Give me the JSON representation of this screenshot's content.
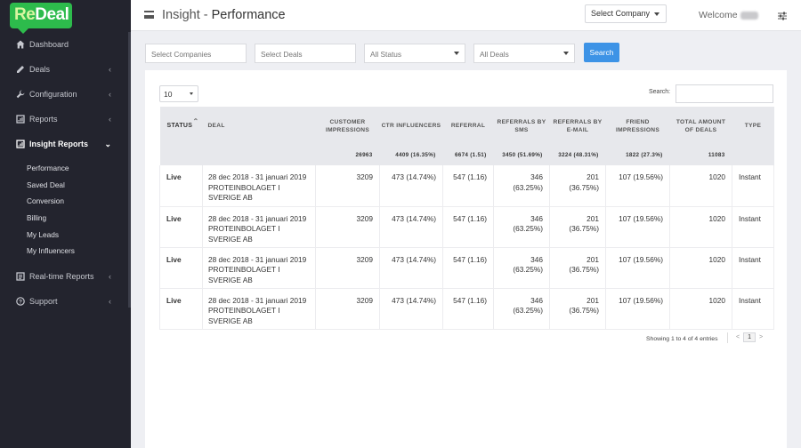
{
  "brand": {
    "logo_re": "Re",
    "logo_rest": "Deal"
  },
  "sidebar": {
    "items": [
      {
        "label": "Dashboard"
      },
      {
        "label": "Deals"
      },
      {
        "label": "Configuration"
      },
      {
        "label": "Reports"
      },
      {
        "label": "Insight Reports"
      },
      {
        "label": "Real-time Reports"
      },
      {
        "label": "Support"
      }
    ],
    "insight_sub": [
      {
        "label": "Performance"
      },
      {
        "label": "Saved Deal"
      },
      {
        "label": "Conversion"
      },
      {
        "label": "Billing"
      },
      {
        "label": "My Leads"
      },
      {
        "label": "My Influencers"
      }
    ]
  },
  "header": {
    "title_prefix": "Insight - ",
    "title_main": "Performance",
    "company_select": "Select Company",
    "welcome": "Welcome"
  },
  "filters": {
    "companies_placeholder": "Select Companies",
    "deals_placeholder": "Select Deals",
    "status": "All Status",
    "deals": "All Deals",
    "search_button": "Search"
  },
  "table_controls": {
    "page_length": "10",
    "search_label": "Search:",
    "info": "Showing 1 to 4 of 4 entries",
    "prev": "<",
    "page": "1",
    "next": ">"
  },
  "table": {
    "headers": [
      {
        "label": "STATUS"
      },
      {
        "label": "DEAL"
      },
      {
        "label": "CUSTOMER IMPRESSIONS"
      },
      {
        "label": "CTR INFLUENCERS"
      },
      {
        "label": "REFERRAL"
      },
      {
        "label": "REFERRALS BY SMS"
      },
      {
        "label": "REFERRALS BY E-MAIL"
      },
      {
        "label": "FRIEND IMPRESSIONS"
      },
      {
        "label": "TOTAL AMOUNT OF DEALS"
      },
      {
        "label": "TYPE"
      }
    ],
    "totals": [
      "",
      "",
      "26963",
      "4409 (16.35%)",
      "6674 (1.51)",
      "3450 (51.69%)",
      "3224 (48.31%)",
      "1822 (27.3%)",
      "11083",
      ""
    ],
    "rows": [
      [
        "Live",
        "28 dec 2018 - 31 januari 2019 PROTEINBOLAGET I SVERIGE AB",
        "3209",
        "473 (14.74%)",
        "547 (1.16)",
        "346 (63.25%)",
        "201 (36.75%)",
        "107 (19.56%)",
        "1020",
        "Instant"
      ],
      [
        "Live",
        "28 dec 2018 - 31 januari 2019 PROTEINBOLAGET I SVERIGE AB",
        "3209",
        "473 (14.74%)",
        "547 (1.16)",
        "346 (63.25%)",
        "201 (36.75%)",
        "107 (19.56%)",
        "1020",
        "Instant"
      ],
      [
        "Live",
        "28 dec 2018 - 31 januari 2019 PROTEINBOLAGET I SVERIGE AB",
        "3209",
        "473 (14.74%)",
        "547 (1.16)",
        "346 (63.25%)",
        "201 (36.75%)",
        "107 (19.56%)",
        "1020",
        "Instant"
      ],
      [
        "Live",
        "28 dec 2018 - 31 januari 2019 PROTEINBOLAGET I SVERIGE AB",
        "3209",
        "473 (14.74%)",
        "547 (1.16)",
        "346 (63.25%)",
        "201 (36.75%)",
        "107 (19.56%)",
        "1020",
        "Instant"
      ]
    ]
  },
  "colors": {
    "sidebar": "#23242e",
    "brand": "#2dbb4c",
    "accent": "#3d93e6"
  },
  "icons": [
    "home-icon",
    "pencil-icon",
    "wrench-icon",
    "report-icon",
    "insight-icon",
    "realtime-icon",
    "help-icon",
    "menu-icon",
    "sliders-icon"
  ]
}
